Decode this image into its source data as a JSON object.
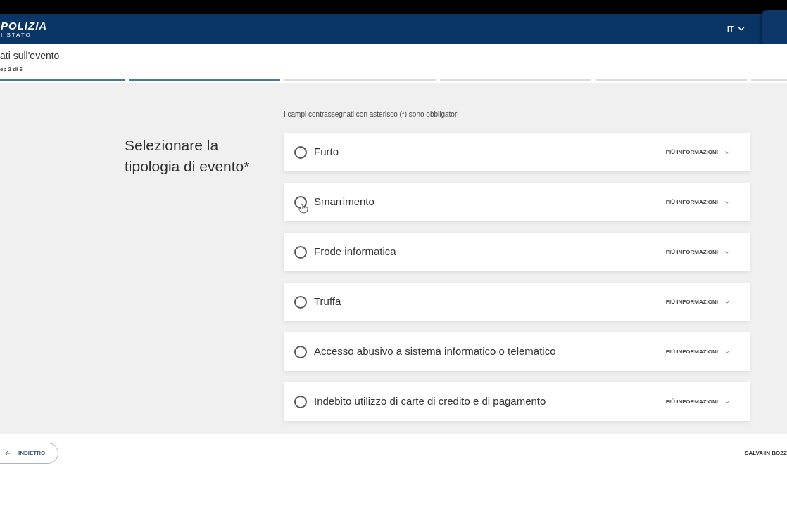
{
  "header": {
    "logo": {
      "title": "POLIZIA",
      "subtitle": "I STATO"
    },
    "language": {
      "label": "IT",
      "expanded": false
    }
  },
  "page_header": {
    "title": "ati sull'evento",
    "step": "ep 2 di 6",
    "steps": [
      {
        "completed": true
      },
      {
        "completed": true
      },
      {
        "completed": false
      },
      {
        "completed": false
      },
      {
        "completed": false
      },
      {
        "completed": false
      }
    ]
  },
  "form": {
    "required_note": "I campi contrassegnati con asterisco (*) sono obbligatori",
    "question": "Selezionare la tipologia di evento*",
    "options": [
      {
        "label": "Furto",
        "selected": false,
        "hovered": false,
        "more": "PIÙ INFORMAZIONI",
        "expanded": false
      },
      {
        "label": "Smarrimento",
        "selected": false,
        "hovered": true,
        "more": "PIÙ INFORMAZIONI",
        "expanded": false
      },
      {
        "label": "Frode informatica",
        "selected": false,
        "hovered": false,
        "more": "PIÙ INFORMAZIONI",
        "expanded": false
      },
      {
        "label": "Truffa",
        "selected": false,
        "hovered": false,
        "more": "PIÙ INFORMAZIONI",
        "expanded": false
      },
      {
        "label": "Accesso abusivo a sistema informatico o telematico",
        "selected": false,
        "hovered": false,
        "more": "PIÙ INFORMAZIONI",
        "expanded": false
      },
      {
        "label": "Indebito utilizzo di carte di credito e di pagamento",
        "selected": false,
        "hovered": false,
        "more": "PIÙ INFORMAZIONI",
        "expanded": false
      }
    ]
  },
  "footer": {
    "back": "INDIETRO",
    "save": "SALVA IN BOZZ"
  }
}
